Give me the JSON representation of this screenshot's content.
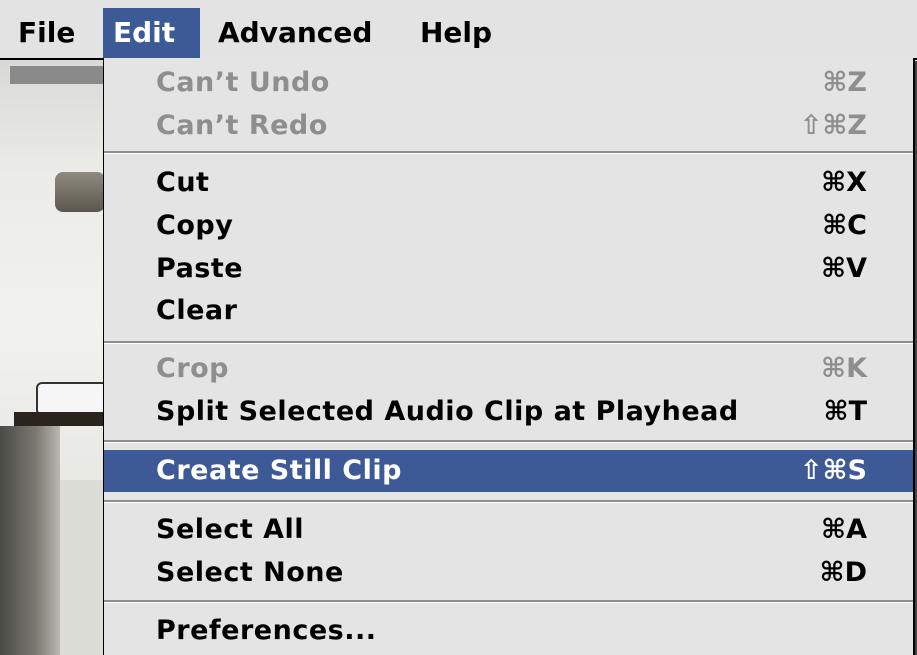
{
  "menubar": {
    "items": [
      {
        "label": "File"
      },
      {
        "label": "Edit"
      },
      {
        "label": "Advanced"
      },
      {
        "label": "Help"
      }
    ],
    "active": "Edit",
    "highlight_color": "#3c5a96"
  },
  "edit_menu": {
    "groups": [
      [
        {
          "label": "Can’t Undo",
          "shortcut": "⌘Z",
          "enabled": false
        },
        {
          "label": "Can’t Redo",
          "shortcut": "⇧⌘Z",
          "enabled": false
        }
      ],
      [
        {
          "label": "Cut",
          "shortcut": "⌘X",
          "enabled": true
        },
        {
          "label": "Copy",
          "shortcut": "⌘C",
          "enabled": true
        },
        {
          "label": "Paste",
          "shortcut": "⌘V",
          "enabled": true
        },
        {
          "label": "Clear",
          "shortcut": "",
          "enabled": true
        }
      ],
      [
        {
          "label": "Crop",
          "shortcut": "⌘K",
          "enabled": false
        },
        {
          "label": "Split Selected Audio Clip at Playhead",
          "shortcut": "⌘T",
          "enabled": true
        }
      ],
      [
        {
          "label": "Create Still Clip",
          "shortcut": "⇧⌘S",
          "enabled": true,
          "selected": true
        }
      ],
      [
        {
          "label": "Select All",
          "shortcut": "⌘A",
          "enabled": true
        },
        {
          "label": "Select None",
          "shortcut": "⌘D",
          "enabled": true
        }
      ],
      [
        {
          "label": "Preferences...",
          "shortcut": "",
          "enabled": true
        }
      ]
    ]
  }
}
